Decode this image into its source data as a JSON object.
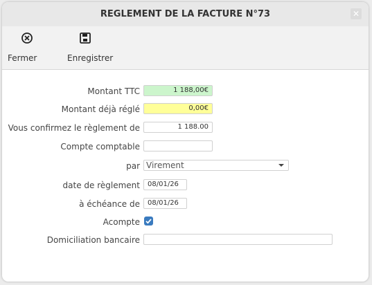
{
  "dialog": {
    "title": "REGLEMENT DE LA FACTURE N°73",
    "close_glyph": "✕"
  },
  "toolbar": {
    "close_label": "Fermer",
    "close_icon": "circle-x-icon",
    "save_label": "Enregistrer",
    "save_icon": "floppy-disk-icon"
  },
  "form": {
    "montant_ttc": {
      "label": "Montant TTC",
      "value": "1 188,00€",
      "bg": "#ccf5cc"
    },
    "deja_regle": {
      "label": "Montant déjà réglé",
      "value": "0,00€",
      "bg": "#ffff99"
    },
    "confirmez": {
      "label": "Vous confirmez le règlement de",
      "value": "1 188.00"
    },
    "compte": {
      "label": "Compte comptable",
      "value": ""
    },
    "par": {
      "label": "par",
      "selected": "Virement"
    },
    "date_reglement": {
      "label": "date de règlement",
      "value": "08/01/26"
    },
    "echeance": {
      "label": "à échéance de",
      "value": "08/01/26"
    },
    "acompte": {
      "label": "Acompte",
      "checked": true,
      "accent": "#3a7bbf"
    },
    "domiciliation": {
      "label": "Domiciliation bancaire",
      "value": ""
    }
  }
}
